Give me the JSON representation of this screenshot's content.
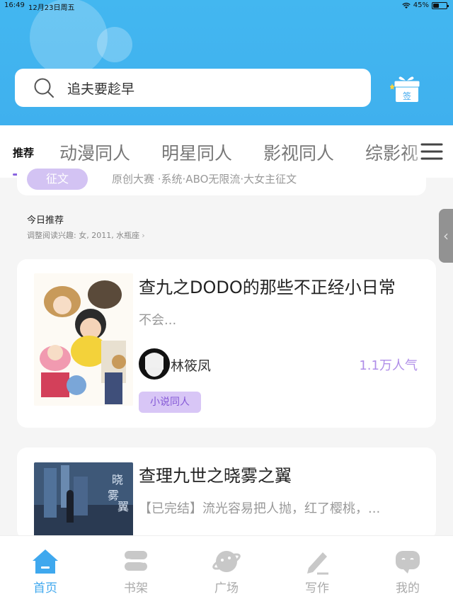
{
  "status": {
    "time": "16:49",
    "date": "12月23日周五",
    "battery": "45%",
    "battery_level": 0.45
  },
  "search": {
    "placeholder": "追夫要趁早"
  },
  "checkin": {
    "label": "签"
  },
  "tabs": [
    {
      "label": "推荐",
      "active": true
    },
    {
      "label": "动漫同人"
    },
    {
      "label": "明星同人"
    },
    {
      "label": "影视同人"
    },
    {
      "label": "综影视"
    }
  ],
  "banner": {
    "tag": "征文",
    "text": "原创大赛 ·系统·ABO无限流·大女主征文"
  },
  "section": {
    "title": "今日推荐",
    "subtitle": "调整阅读兴趣: 女, 2011, 水瓶座"
  },
  "books": [
    {
      "title": "查九之DODO的那些不正经小日常",
      "desc": "不会...",
      "author": "林筱凤",
      "popularity": "1.1万人气",
      "tag": "小说同人"
    },
    {
      "title": "查理九世之晓雾之翼",
      "desc": "【已完结】流光容易把人抛，红了樱桃，..."
    }
  ],
  "nav": [
    {
      "label": "首页",
      "icon": "home-icon",
      "active": true
    },
    {
      "label": "书架",
      "icon": "bookshelf-icon"
    },
    {
      "label": "广场",
      "icon": "planet-icon"
    },
    {
      "label": "写作",
      "icon": "pen-icon"
    },
    {
      "label": "我的",
      "icon": "chat-bubble-icon"
    }
  ],
  "colors": {
    "header": "#43b7f0",
    "accent": "#8a64e0",
    "tag_bg": "#d8c6f6",
    "nav_active": "#3fa8ee"
  }
}
